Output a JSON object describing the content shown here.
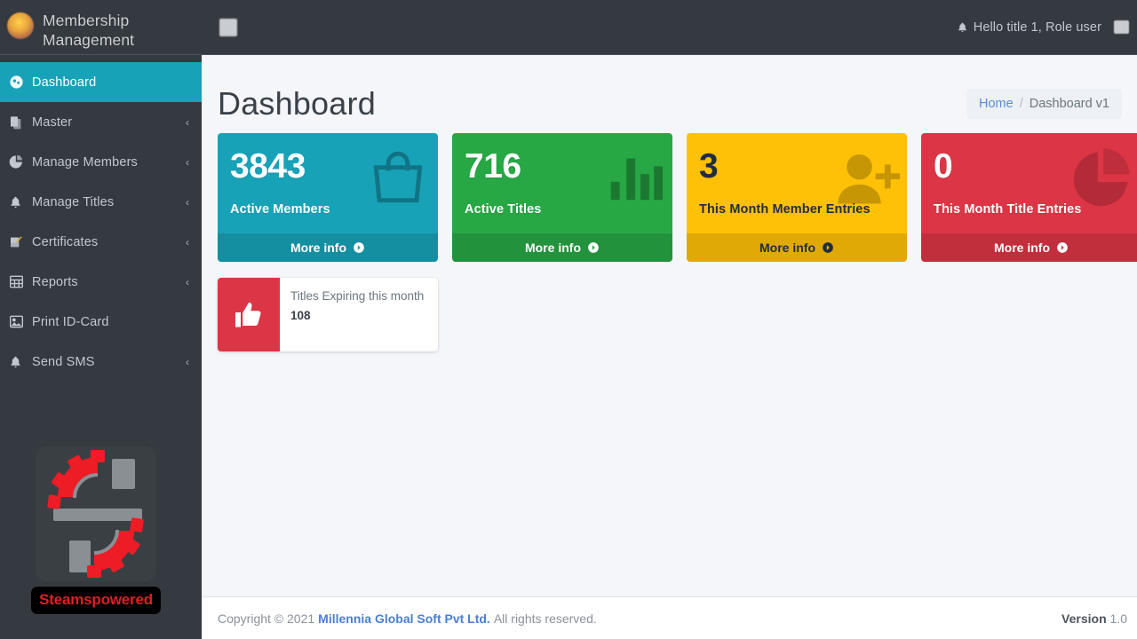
{
  "sidebar": {
    "brand_title": "Membership\nManagement",
    "avatar_name": "user-avatar",
    "items": [
      {
        "label": "Dashboard",
        "icon": "dashboard-icon",
        "active": true,
        "caret": false
      },
      {
        "label": "Master",
        "icon": "copy-icon",
        "active": false,
        "caret": true
      },
      {
        "label": "Manage Members",
        "icon": "pie-chart-icon",
        "active": false,
        "caret": true
      },
      {
        "label": "Manage Titles",
        "icon": "bell-icon",
        "active": false,
        "caret": true
      },
      {
        "label": "Certificates",
        "icon": "edit-square-icon",
        "active": false,
        "caret": true
      },
      {
        "label": "Reports",
        "icon": "table-grid-icon",
        "active": false,
        "caret": true
      },
      {
        "label": "Print ID-Card",
        "icon": "image-icon",
        "active": false,
        "caret": false
      },
      {
        "label": "Send SMS",
        "icon": "bell-icon",
        "active": false,
        "caret": true
      }
    ],
    "caret_glyph": "‹",
    "watermark": {
      "label": "Steamspowered",
      "icon": "gear-logo-icon"
    }
  },
  "topbar": {
    "menu_toggle": "hamburger-icon",
    "greeting": "Hello title 1, Role user",
    "bell_icon": "bell-icon",
    "edge_icon": "fullscreen-icon"
  },
  "content": {
    "page_title": "Dashboard",
    "breadcrumb": {
      "home": "Home",
      "separator": "/",
      "current": "Dashboard v1"
    }
  },
  "cards": [
    {
      "number": "3843",
      "label": "Active Members",
      "more_info": "More info",
      "icon": "shopping-bag-icon",
      "color": "#17a2b8",
      "theme": "teal"
    },
    {
      "number": "716",
      "label": "Active Titles",
      "more_info": "More info",
      "icon": "bar-chart-icon",
      "color": "#28a745",
      "theme": "green"
    },
    {
      "number": "3",
      "label": "This Month Member Entries",
      "more_info": "More info",
      "icon": "user-plus-icon",
      "color": "#ffc107",
      "theme": "yellow"
    },
    {
      "number": "0",
      "label": "This Month Title Entries",
      "more_info": "More info",
      "icon": "pie-chart-icon",
      "color": "#dc3545",
      "theme": "red"
    }
  ],
  "infobox": {
    "icon": "thumbs-up-icon",
    "icon_color": "#dc3545",
    "text": "Titles Expiring this month",
    "number": "108"
  },
  "footer": {
    "copyright_prefix": "Copyright © 2021",
    "company": "Millennia Global Soft Pvt Ltd.",
    "rights": "All rights reserved.",
    "version_label": "Version",
    "version_value": "1.0"
  }
}
